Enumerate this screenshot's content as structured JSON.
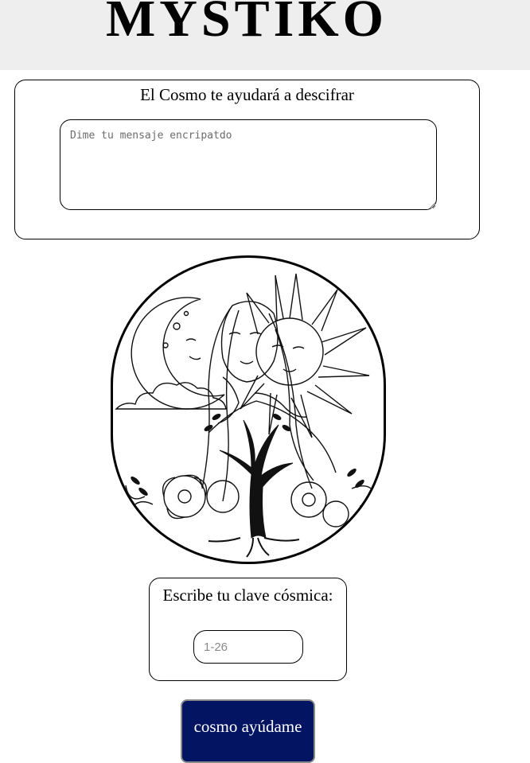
{
  "header": {
    "brand": "MYSTIKO"
  },
  "decrypt": {
    "title": "El Cosmo te ayudará a descifrar",
    "message_placeholder": "Dime tu mensaje encripatdo",
    "message_value": ""
  },
  "illustration": {
    "icon": "moon-sun-woman-tree-illustration"
  },
  "key": {
    "label": "Escribe tu clave cósmica:",
    "placeholder": "1-26",
    "value": ""
  },
  "action": {
    "button_label": "cosmo ayúdame"
  },
  "colors": {
    "header_bg": "#eeeeee",
    "button_bg": "#031463",
    "text": "#000000"
  }
}
